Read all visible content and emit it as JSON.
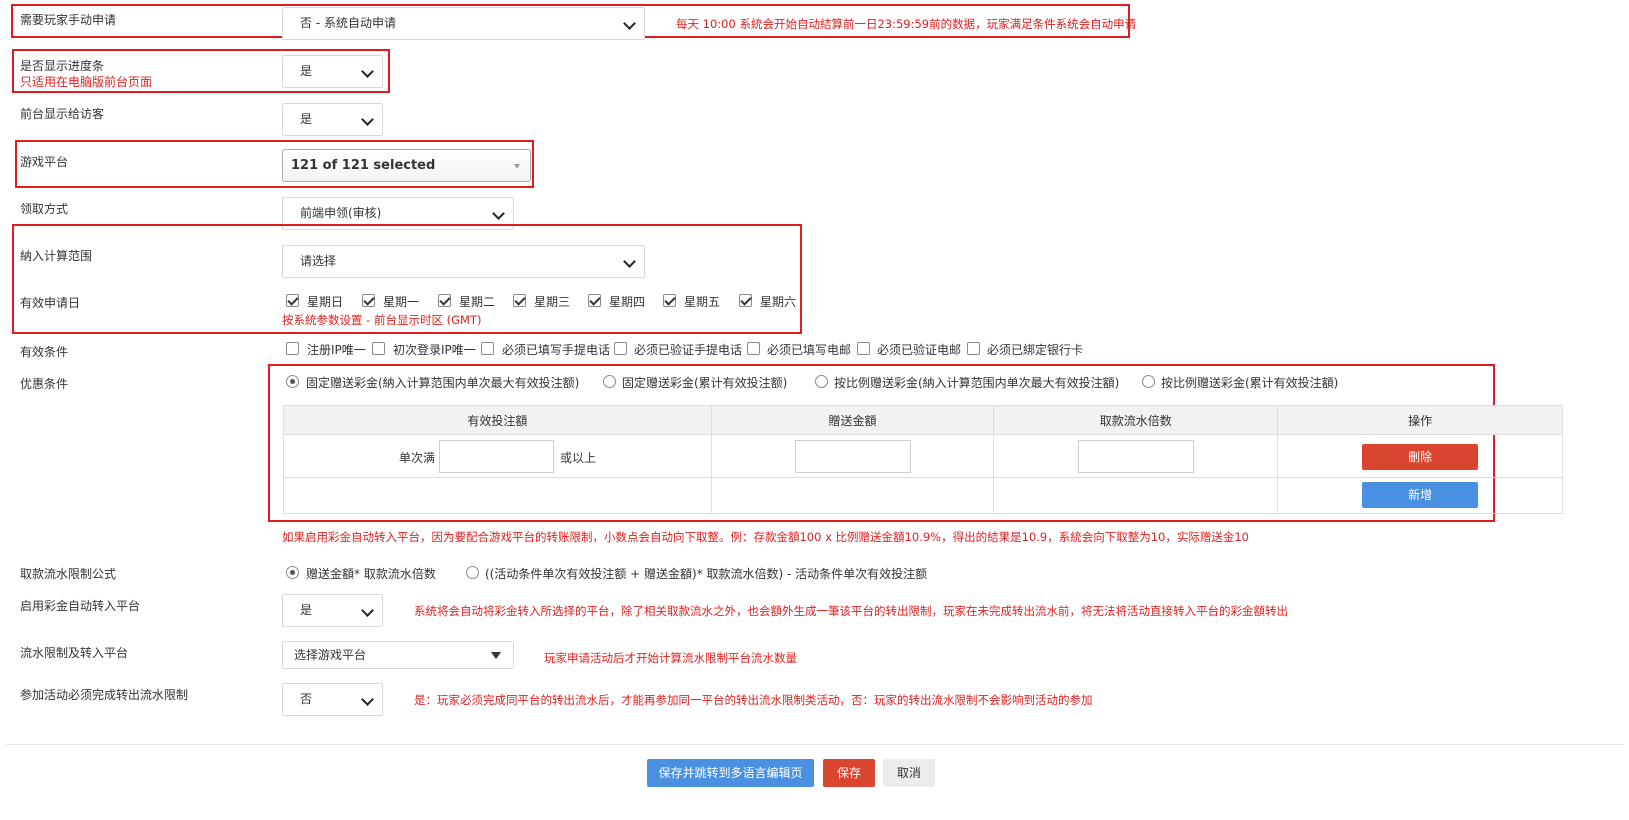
{
  "fields": {
    "manual_apply": {
      "label": "需要玩家手动申请",
      "value": "否 - 系统自动申请",
      "note": "每天 10:00 系統会开始自动結算前一日23:59:59前的数据，玩家满足条件系统会自动申请"
    },
    "show_progress": {
      "label": "是否显示进度条",
      "sublabel": "只适用在电脑版前台页面",
      "value": "是"
    },
    "show_to_guests": {
      "label": "前台显示给访客",
      "value": "是"
    },
    "game_platform": {
      "label": "游戏平台",
      "value": "121 of 121 selected"
    },
    "claim_method": {
      "label": "领取方式",
      "value": "前端申领(审核)"
    },
    "calc_scope": {
      "label": "納入计算范围",
      "value": "请选择"
    },
    "valid_days": {
      "label": "有效申请日",
      "days": [
        "星期日",
        "星期一",
        "星期二",
        "星期三",
        "星期四",
        "星期五",
        "星期六"
      ],
      "note": "按系統参数设置 - 前台显示时区 (GMT)"
    },
    "valid_conditions": {
      "label": "有效条件",
      "options": [
        "注册IP唯一",
        "初次登录IP唯一",
        "必须已填写手提电话",
        "必须已验证手提电话",
        "必须已填写电邮",
        "必须已验证电邮",
        "必须已綁定银行卡"
      ]
    },
    "promo_conditions": {
      "label": "优惠条件",
      "options": [
        "固定赠送彩金(納入计算范围内单次最大有效投注额)",
        "固定赠送彩金(累计有效投注额)",
        "按比例赠送彩金(納入计算范围内单次最大有效投注額)",
        "按比例赠送彩金(累计有效投注額)"
      ],
      "table": {
        "headers": [
          "有效投注額",
          "贈送金額",
          "取款流水倍数",
          "操作"
        ],
        "prefix": "单次满",
        "suffix": "或以上",
        "delete_label": "刪除",
        "add_label": "新增"
      },
      "note": "如果启用彩金自动转入平台，因为要配合游戏平台的转账限制，小数点会自动向下取整。例：存款金額100 x 比例赠送金額10.9%，得出的結果是10.9，系統会向下取整为10，实际赠送金10"
    },
    "turnover_formula": {
      "label": "取款流水限制公式",
      "options": [
        "赠送金額* 取款流水倍数",
        "((活动条件单次有效投注额 + 赠送金額)* 取款流水倍数) - 活动条件单次有效投注额"
      ]
    },
    "auto_transfer": {
      "label": "启用彩金自动转入平台",
      "value": "是",
      "note": "系统将会自动将彩金转入所选择的平台，除了相关取款流水之外，也会額外生成一筆该平台的转出限制，玩家在未完成转出流水前，将无法将活动直接转入平台的彩金額转出"
    },
    "turnover_platform": {
      "label": "流水限制及转入平台",
      "value": "选择游戏平台",
      "note": "玩家申请活动后才开始计算流水限制平台流水数量"
    },
    "must_complete": {
      "label": "参加活动必须完成转出流水限制",
      "value": "否",
      "note": "是：玩家必须完成同平台的转出流水后，才能再参加同一平台的转出流水限制类活动，否：玩家的转出流水限制不会影响到活动的参加"
    }
  },
  "footer": {
    "save_redirect": "保存并跳转到多语言编辑页",
    "save": "保存",
    "cancel": "取消"
  }
}
